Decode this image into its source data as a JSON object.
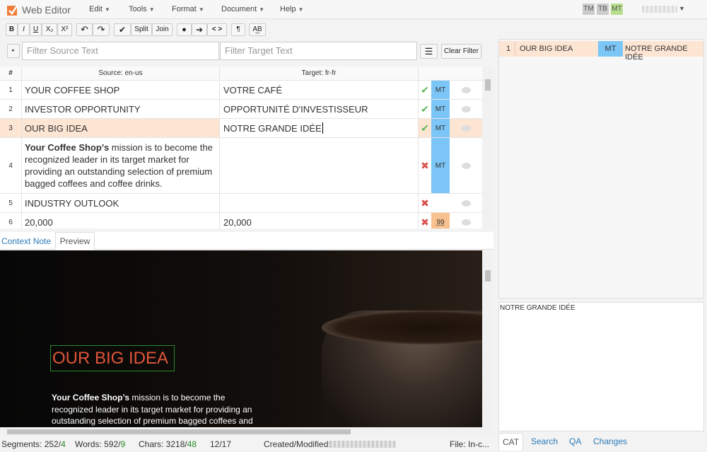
{
  "app": {
    "title": "Web Editor"
  },
  "menu": [
    "Edit",
    "Tools",
    "Format",
    "Document",
    "Help"
  ],
  "toggles": [
    "TM",
    "TB",
    "MT"
  ],
  "toolbar": {
    "bold": "B",
    "italic": "I",
    "underline": "U",
    "subscript": "X₂",
    "superscript": "X²",
    "split": "Split",
    "join": "Join",
    "pilcrow": "¶",
    "tags": "< >",
    "spell": "A͢B"
  },
  "filters": {
    "source_placeholder": "Filter Source Text",
    "target_placeholder": "Filter Target Text",
    "clear_label": "Clear Filter"
  },
  "grid": {
    "headers": {
      "num": "#",
      "source": "Source: en-us",
      "target": "Target: fr-fr"
    },
    "rows": [
      {
        "num": "1",
        "source": "YOUR COFFEE SHOP",
        "target": "VOTRE CAFÉ",
        "status": "✔",
        "mt": "MT"
      },
      {
        "num": "2",
        "source": "INVESTOR OPPORTUNITY",
        "target": "OPPORTUNITÉ D'INVESTISSEUR",
        "status": "✔",
        "mt": "MT"
      },
      {
        "num": "3",
        "source": "OUR BIG IDEA",
        "target": "NOTRE GRANDE IDÉE",
        "status": "✔",
        "mt": "MT"
      },
      {
        "num": "4",
        "source_bold": "Your Coffee Shop’s",
        "source": " mission is to become the recognized leader in its target market for providing an outstanding selection of premium bagged coffees and coffee drinks.",
        "target": "",
        "status": "✖",
        "mt": "MT"
      },
      {
        "num": "5",
        "source": "INDUSTRY OUTLOOK",
        "target": "",
        "status": "✖",
        "mt": ""
      },
      {
        "num": "6",
        "source": "20,000",
        "target": "20,000",
        "status": "✖",
        "mt": "99"
      }
    ]
  },
  "lower_tabs": {
    "context": "Context Note",
    "preview": "Preview"
  },
  "preview": {
    "heading": "OUR BIG IDEA",
    "text_bold": "Your Coffee Shop’s",
    "text": " mission is to become the recognized leader in its target market for providing an outstanding selection of premium bagged coffees and coffee drinks."
  },
  "status": {
    "segments_label": "Segments: 252/",
    "segments_done": "4",
    "words_label": "Words: 592/",
    "words_done": "9",
    "chars_label": "Chars: 3218/",
    "chars_done": "48",
    "page": "12/17",
    "created": "Created/Modified:",
    "file": "File: In-c..."
  },
  "right": {
    "match": {
      "num": "1",
      "source": "OUR BIG IDEA",
      "type": "MT",
      "target": "NOTRE GRANDE IDÉE"
    },
    "preview_text": "NOTRE GRANDE IDÉE",
    "tabs": [
      "CAT",
      "Search",
      "QA",
      "Changes"
    ]
  },
  "colors": {
    "mt_blue": "#7cc6f7",
    "selected_row": "#fde5d4",
    "fuzzy_orange": "#f9c18f",
    "check_green": "#5cb85c",
    "cross_red": "#d9534f"
  }
}
